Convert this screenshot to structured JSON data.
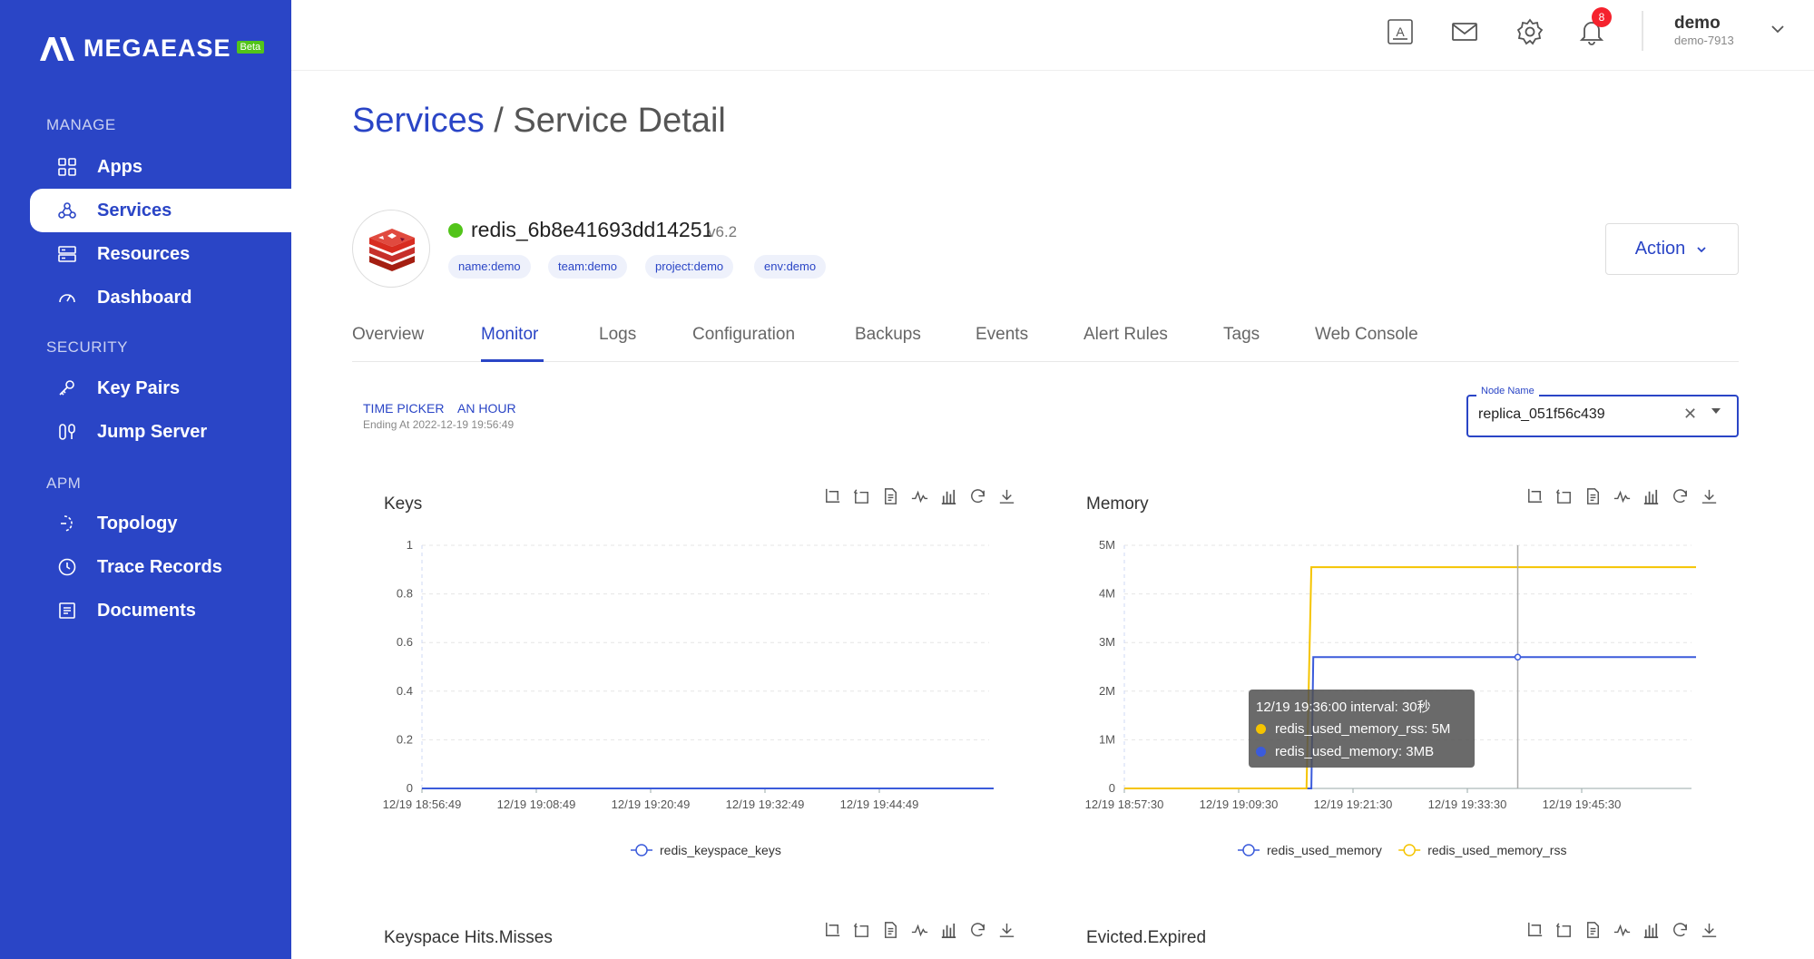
{
  "brand": {
    "name": "MEGAEASE",
    "beta": "Beta"
  },
  "sidebar": {
    "sections": [
      {
        "title": "MANAGE",
        "items": [
          {
            "label": "Apps",
            "icon": "apps-grid-icon"
          },
          {
            "label": "Services",
            "icon": "services-icon",
            "active": true
          },
          {
            "label": "Resources",
            "icon": "server-icon"
          },
          {
            "label": "Dashboard",
            "icon": "gauge-icon"
          }
        ]
      },
      {
        "title": "SECURITY",
        "items": [
          {
            "label": "Key Pairs",
            "icon": "key-icon"
          },
          {
            "label": "Jump Server",
            "icon": "jump-server-icon"
          }
        ]
      },
      {
        "title": "APM",
        "items": [
          {
            "label": "Topology",
            "icon": "topology-icon"
          },
          {
            "label": "Trace Records",
            "icon": "clock-icon"
          },
          {
            "label": "Documents",
            "icon": "document-icon"
          }
        ]
      }
    ]
  },
  "header": {
    "notification_count": "8",
    "user_name": "demo",
    "user_id": "demo-7913"
  },
  "breadcrumb": {
    "parent": "Services",
    "separator": " / ",
    "current": "Service Detail"
  },
  "service": {
    "name": "redis_6b8e41693dd14251",
    "version": "v6.2",
    "status_color": "#52c41a",
    "tags": [
      "name:demo",
      "team:demo",
      "project:demo",
      "env:demo"
    ],
    "action_label": "Action"
  },
  "tabs": [
    "Overview",
    "Monitor",
    "Logs",
    "Configuration",
    "Backups",
    "Events",
    "Alert Rules",
    "Tags",
    "Web Console"
  ],
  "active_tab": "Monitor",
  "time_picker": {
    "label": "TIME PICKER",
    "value": "AN HOUR",
    "ending": "Ending At 2022-12-19 19:56:49"
  },
  "node_select": {
    "legend": "Node Name",
    "value": "replica_051f56c439"
  },
  "tooltip": {
    "title": "12/19 19:36:00 interval: 30秒",
    "rows": [
      {
        "text": "redis_used_memory_rss: 5M",
        "color": "#f5c400"
      },
      {
        "text": "redis_used_memory: 3MB",
        "color": "#3b5bdb"
      }
    ]
  },
  "chart_titles": [
    "Keys",
    "Memory",
    "Keyspace Hits.Misses",
    "Evicted.Expired"
  ],
  "chart_data": [
    {
      "type": "line",
      "title": "Keys",
      "x_ticks": [
        "12/19 18:56:49",
        "12/19 19:08:49",
        "12/19 19:20:49",
        "12/19 19:32:49",
        "12/19 19:44:49"
      ],
      "y_ticks": [
        "0",
        "0.2",
        "0.4",
        "0.6",
        "0.8",
        "1"
      ],
      "ylim": [
        0,
        1
      ],
      "series": [
        {
          "name": "redis_keyspace_keys",
          "color": "#3b5bdb",
          "values": [
            0,
            0,
            0,
            0,
            0,
            0
          ]
        }
      ]
    },
    {
      "type": "line",
      "title": "Memory",
      "x_ticks": [
        "12/19 18:57:30",
        "12/19 19:09:30",
        "12/19 19:21:30",
        "12/19 19:33:30",
        "12/19 19:45:30"
      ],
      "y_ticks": [
        "0",
        "1M",
        "2M",
        "3M",
        "4M",
        "5M"
      ],
      "ylim": [
        0,
        5
      ],
      "series": [
        {
          "name": "redis_used_memory",
          "color": "#3b5bdb",
          "x": [
            0,
            19.3,
            19.5,
            59
          ],
          "values": [
            0,
            0,
            2.7,
            2.7
          ]
        },
        {
          "name": "redis_used_memory_rss",
          "color": "#f5c400",
          "x": [
            0,
            18.8,
            19.3,
            59
          ],
          "values": [
            0,
            0,
            4.55,
            4.55
          ]
        }
      ]
    }
  ]
}
